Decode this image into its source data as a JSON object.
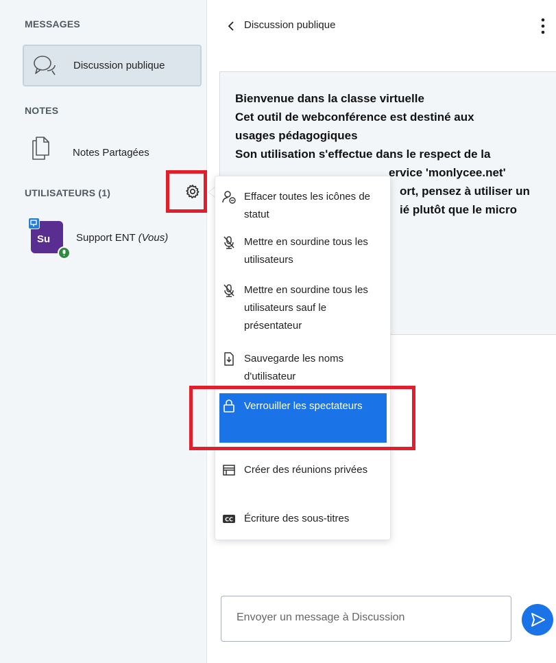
{
  "sidebar": {
    "messages_title": "MESSAGES",
    "public_chat_label": "Discussion publique",
    "notes_title": "NOTES",
    "shared_notes_label": "Notes Partagées",
    "users_title": "UTILISATEURS (1)",
    "user": {
      "initials": "Su",
      "name": "Support ENT",
      "you_label": "(Vous)",
      "avatar_color": "#5a2d91"
    }
  },
  "chat": {
    "header_title": "Discussion publique",
    "welcome_lines": [
      "Bienvenue dans la classe virtuelle",
      "Cet outil de webconférence est destiné aux",
      "usages pédagogiques",
      "Son utilisation s'effectue dans le respect de la",
      "ervice 'monlycee.net'",
      "ort, pensez à utiliser un",
      "ié plutôt que le micro"
    ],
    "input_placeholder": "Envoyer un message à Discussion"
  },
  "menu": {
    "items": [
      {
        "label": "Effacer toutes les icônes de statut",
        "icon": "clear-status-icon"
      },
      {
        "label": "Mettre en sourdine tous les utilisateurs",
        "icon": "mute-icon"
      },
      {
        "label": "Mettre en sourdine tous les utilisateurs sauf le présentateur",
        "icon": "mute-icon"
      },
      {
        "label": "Sauvegarde les noms d'utilisateur",
        "icon": "download-icon"
      },
      {
        "label": "Verrouiller les spectateurs",
        "icon": "lock-icon",
        "active": true
      },
      {
        "label": "Créer des réunions privées",
        "icon": "breakout-icon"
      },
      {
        "label": "Écriture des sous-titres",
        "icon": "closed-captions-icon"
      }
    ]
  },
  "colors": {
    "accent": "#1b73e8",
    "highlight": "#e11e2b",
    "sidebar_bg": "#f3f6f9"
  }
}
